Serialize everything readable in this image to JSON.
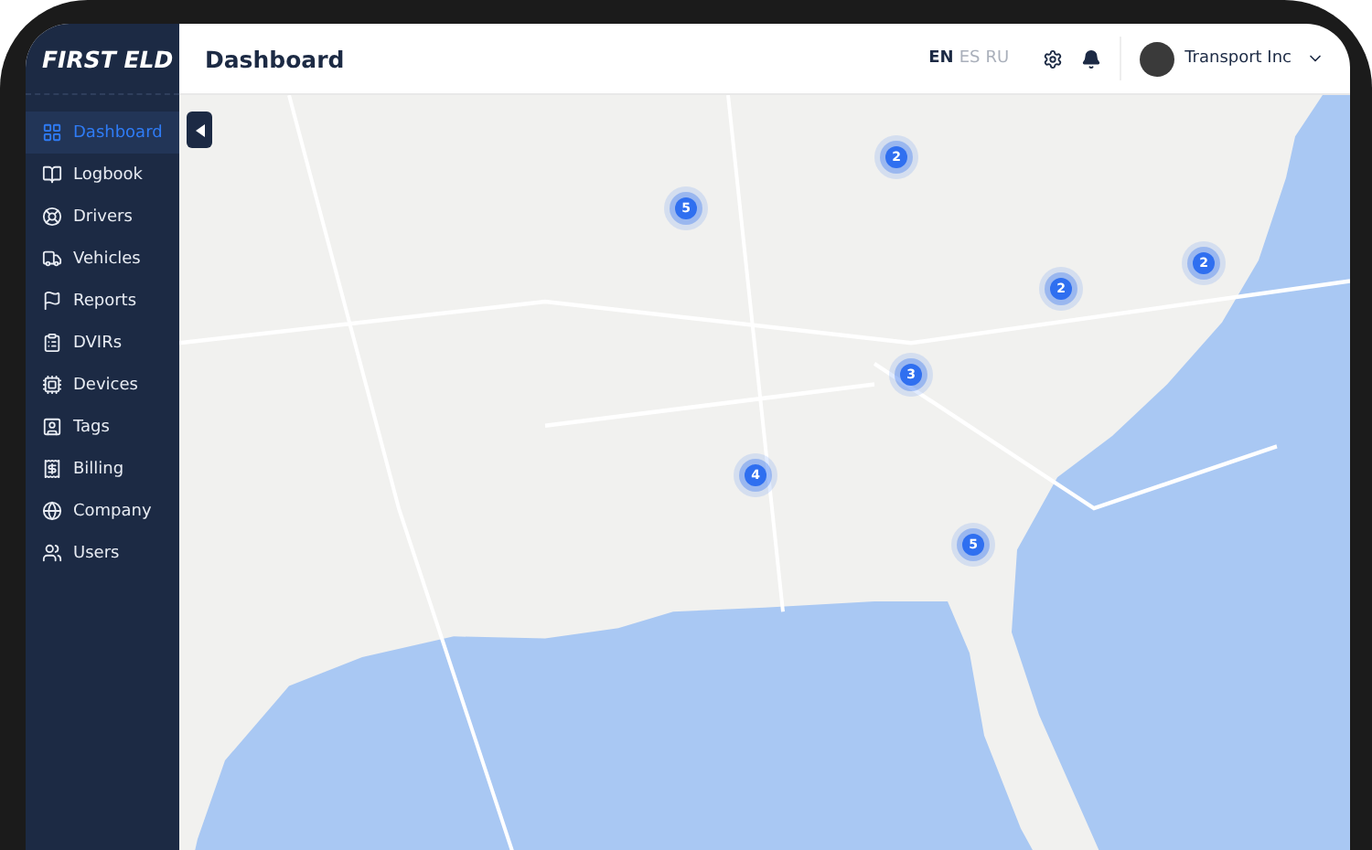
{
  "sidebar": {
    "logo": "FIRST ELD",
    "items": [
      {
        "label": "Dashboard",
        "selected": true
      },
      {
        "label": "Logbook",
        "selected": false
      },
      {
        "label": "Drivers",
        "selected": false
      },
      {
        "label": "Vehicles",
        "selected": false
      },
      {
        "label": "Reports",
        "selected": false
      },
      {
        "label": "DVIRs",
        "selected": false
      },
      {
        "label": "Devices",
        "selected": false
      },
      {
        "label": "Tags",
        "selected": false
      },
      {
        "label": "Billing",
        "selected": false
      },
      {
        "label": "Company",
        "selected": false
      },
      {
        "label": "Users",
        "selected": false
      }
    ]
  },
  "header": {
    "title": "Dashboard",
    "languages": [
      {
        "label": "EN",
        "selected": true
      },
      {
        "label": "ES",
        "selected": false
      },
      {
        "label": "RU",
        "selected": false
      }
    ],
    "account": "Transport Inc"
  },
  "map": {
    "clusters": [
      "5",
      "2",
      "2",
      "2",
      "3",
      "4",
      "5"
    ]
  }
}
